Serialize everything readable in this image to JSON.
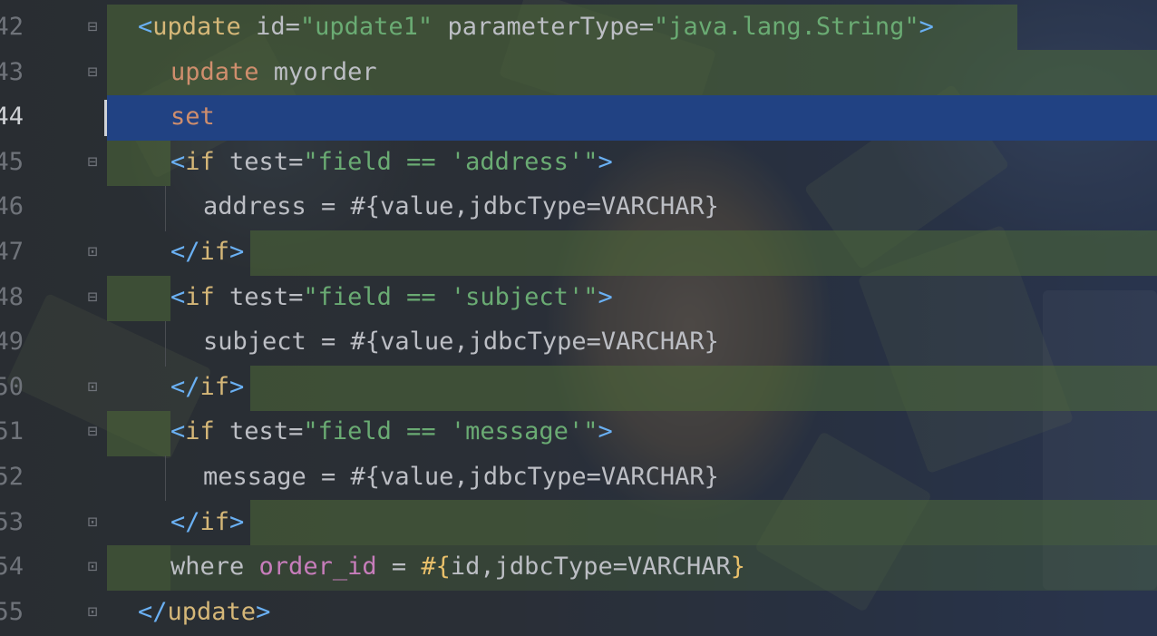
{
  "editor": {
    "current_line": "44",
    "lines": [
      {
        "num": "42",
        "tokens": [
          [
            "tok-br",
            "<"
          ],
          [
            "tok-tag",
            "update"
          ],
          [
            "tok-plain",
            " "
          ],
          [
            "tok-attr",
            "id"
          ],
          [
            "tok-plain",
            "="
          ],
          [
            "tok-str",
            "\"update1\""
          ],
          [
            "tok-plain",
            " "
          ],
          [
            "tok-attr",
            "parameterType"
          ],
          [
            "tok-plain",
            "="
          ],
          [
            "tok-str",
            "\"java.lang.String\""
          ],
          [
            "tok-br",
            ">"
          ]
        ]
      },
      {
        "num": "43",
        "tokens": [
          [
            "tok-kw",
            "update"
          ],
          [
            "tok-plain",
            " myorder"
          ]
        ]
      },
      {
        "num": "44",
        "tokens": [
          [
            "tok-kw",
            "set"
          ]
        ]
      },
      {
        "num": "45",
        "tokens": [
          [
            "tok-br",
            "<"
          ],
          [
            "tok-tag",
            "if"
          ],
          [
            "tok-plain",
            " "
          ],
          [
            "tok-attr",
            "test"
          ],
          [
            "tok-plain",
            "="
          ],
          [
            "tok-str",
            "\"field == 'address'\""
          ],
          [
            "tok-br",
            ">"
          ]
        ]
      },
      {
        "num": "46",
        "tokens": [
          [
            "tok-plain",
            "address = #{value,jdbcType=VARCHAR}"
          ]
        ]
      },
      {
        "num": "47",
        "tokens": [
          [
            "tok-br",
            "</"
          ],
          [
            "tok-tag",
            "if"
          ],
          [
            "tok-br",
            ">"
          ]
        ]
      },
      {
        "num": "48",
        "tokens": [
          [
            "tok-br",
            "<"
          ],
          [
            "tok-tag",
            "if"
          ],
          [
            "tok-plain",
            " "
          ],
          [
            "tok-attr",
            "test"
          ],
          [
            "tok-plain",
            "="
          ],
          [
            "tok-str",
            "\"field == 'subject'\""
          ],
          [
            "tok-br",
            ">"
          ]
        ]
      },
      {
        "num": "49",
        "tokens": [
          [
            "tok-plain",
            "subject = #{value,jdbcType=VARCHAR}"
          ]
        ]
      },
      {
        "num": "50",
        "tokens": [
          [
            "tok-br",
            "</"
          ],
          [
            "tok-tag",
            "if"
          ],
          [
            "tok-br",
            ">"
          ]
        ]
      },
      {
        "num": "51",
        "tokens": [
          [
            "tok-br",
            "<"
          ],
          [
            "tok-tag",
            "if"
          ],
          [
            "tok-plain",
            " "
          ],
          [
            "tok-attr",
            "test"
          ],
          [
            "tok-plain",
            "="
          ],
          [
            "tok-str",
            "\"field == 'message'\""
          ],
          [
            "tok-br",
            ">"
          ]
        ]
      },
      {
        "num": "52",
        "tokens": [
          [
            "tok-plain",
            "message = #{value,jdbcType=VARCHAR}"
          ]
        ]
      },
      {
        "num": "53",
        "tokens": [
          [
            "tok-br",
            "</"
          ],
          [
            "tok-tag",
            "if"
          ],
          [
            "tok-br",
            ">"
          ]
        ]
      },
      {
        "num": "54",
        "tokens": [
          [
            "tok-plain",
            "where "
          ],
          [
            "tok-purple",
            "order_id"
          ],
          [
            "tok-plain",
            " = "
          ],
          [
            "tok-yellow",
            "#{"
          ],
          [
            "tok-plain",
            "id,jdbcType=VARCHAR"
          ],
          [
            "tok-yellow",
            "}"
          ]
        ]
      },
      {
        "num": "55",
        "tokens": [
          [
            "tok-br",
            "</"
          ],
          [
            "tok-tag",
            "update"
          ],
          [
            "tok-br",
            ">"
          ]
        ]
      }
    ]
  },
  "colors": {
    "selection": "#214283",
    "tag": "#d5b778",
    "bracket": "#6ab0f3",
    "string": "#6aab73",
    "keyword": "#cf8e6d"
  }
}
